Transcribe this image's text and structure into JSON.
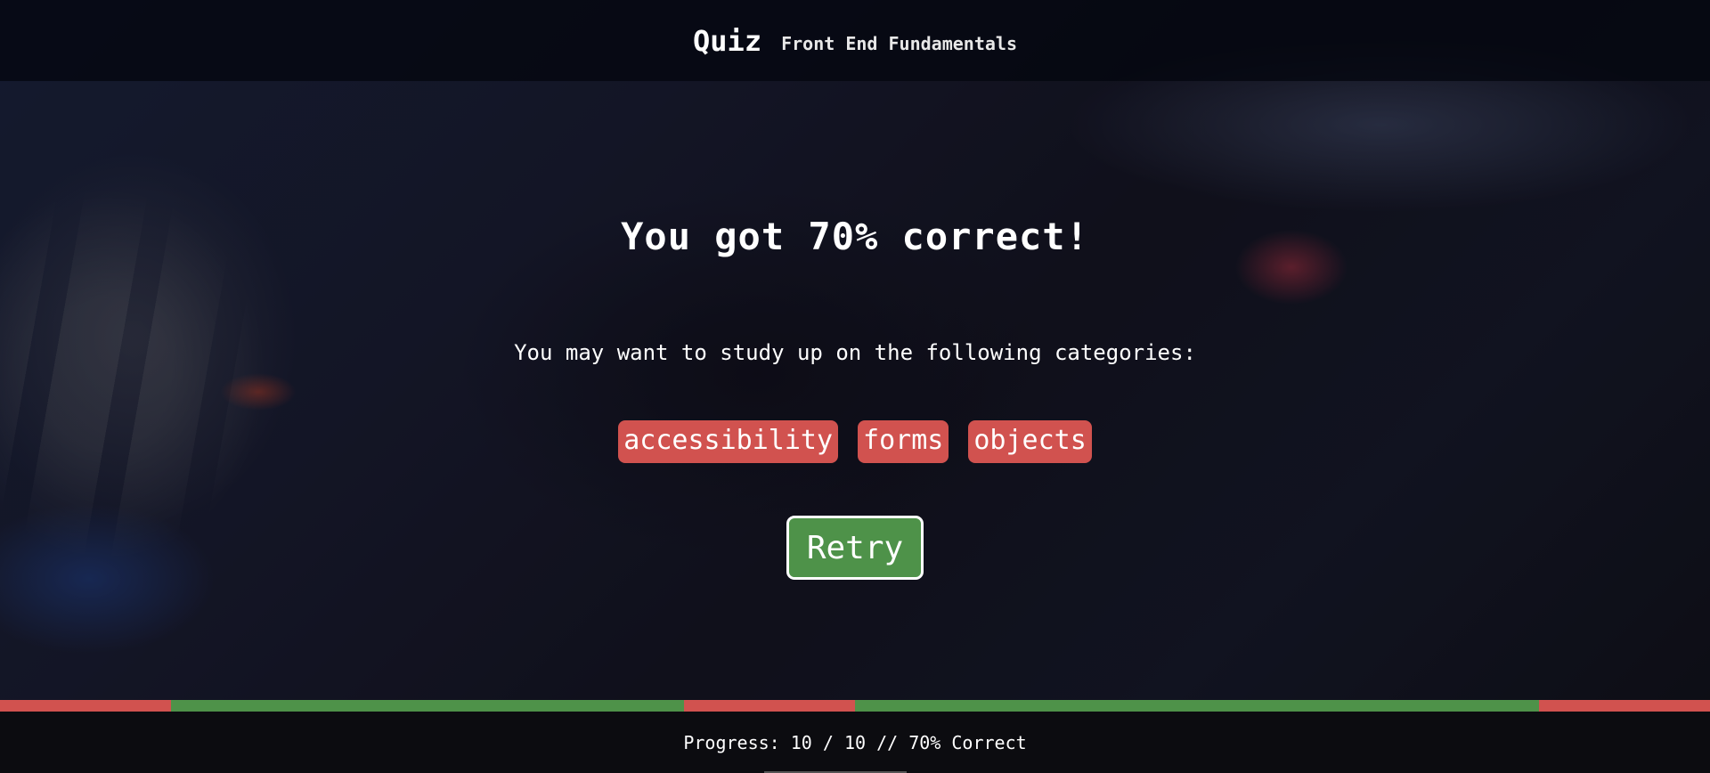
{
  "header": {
    "title": "Quiz",
    "subtitle": "Front End Fundamentals"
  },
  "result": {
    "score_text": "You got 70% correct!",
    "study_text": "You may want to study up on the following categories:",
    "categories": [
      "accessibility",
      "forms",
      "objects"
    ],
    "retry_label": "Retry"
  },
  "progress": {
    "answered": 10,
    "total": 10,
    "percent_correct": 70,
    "text": "Progress: 10 / 10 // 70% Correct",
    "answers": [
      "incorrect",
      "correct",
      "correct",
      "correct",
      "incorrect",
      "correct",
      "correct",
      "correct",
      "correct",
      "incorrect"
    ]
  },
  "colors": {
    "correct": "#4e9249",
    "incorrect": "#d1524f",
    "chip": "#d1524f",
    "retry": "#4e9249"
  }
}
